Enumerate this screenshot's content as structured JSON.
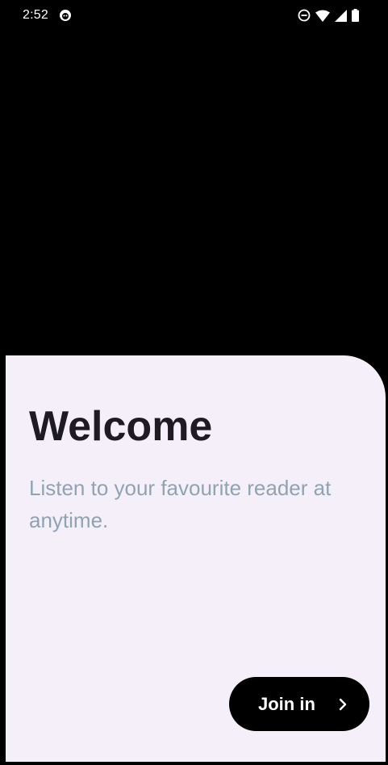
{
  "status_bar": {
    "time": "2:52",
    "icons": [
      "app-notification-icon",
      "do-not-disturb-icon",
      "wifi-icon",
      "cellular-signal-icon",
      "battery-icon"
    ]
  },
  "welcome": {
    "title": "Welcome",
    "subtitle": "Listen to your favourite reader at anytime."
  },
  "actions": {
    "join_label": "Join in",
    "join_icon": "chevron-right-icon"
  },
  "colors": {
    "background": "#000000",
    "sheet": "#f5eff9",
    "title": "#1e1b22",
    "subtitle": "#8fa3b3",
    "button": "#000000",
    "button_text": "#ffffff"
  }
}
